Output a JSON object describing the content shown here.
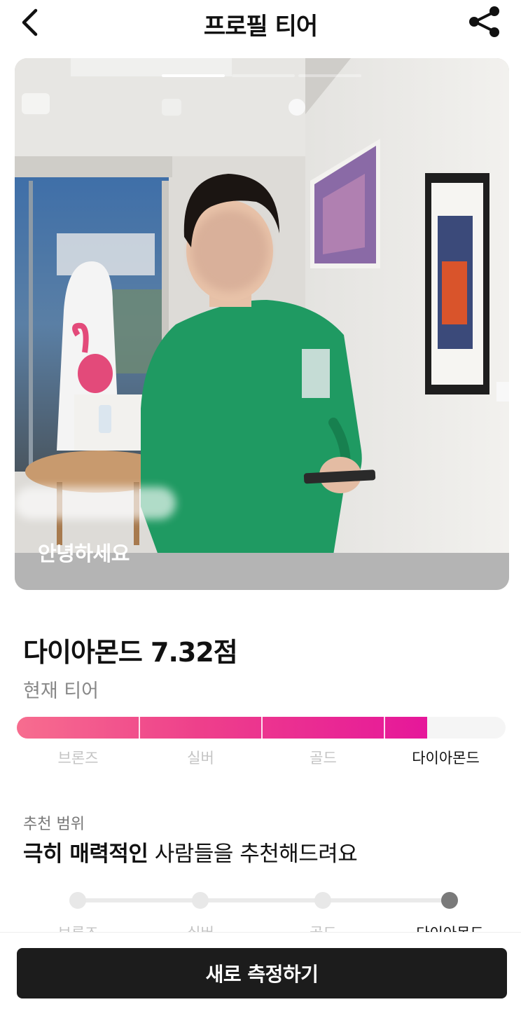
{
  "header": {
    "title": "프로필 티어",
    "back_icon": "chevron-left-icon",
    "share_icon": "share-icon"
  },
  "photo": {
    "caption": "안녕하세요",
    "page_count": 3,
    "active_index": 0
  },
  "result": {
    "score_title": "다이아몬드 7.32점",
    "tier_subtitle": "현재 티어"
  },
  "tier_bar": {
    "labels": [
      "브론즈",
      "실버",
      "골드",
      "다이아몬드"
    ],
    "current_index": 3,
    "progress_percent": 84,
    "fill_color": "#e6179a"
  },
  "recommend": {
    "caption": "추천 범위",
    "highlight": "극히 매력적인",
    "rest": " 사람들을 추천해드려요",
    "steps": [
      "브론즈",
      "실버",
      "골드",
      "다이아몬드"
    ],
    "active_index": 3
  },
  "cta": {
    "label": "새로 측정하기"
  }
}
